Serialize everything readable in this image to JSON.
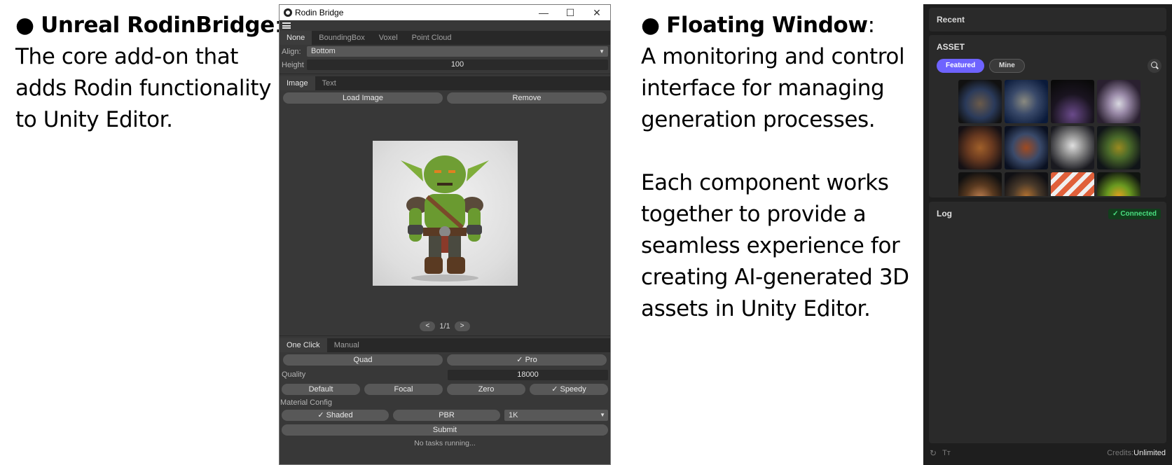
{
  "left_text": {
    "bullet": "●",
    "heading": "Unreal RodinBridge",
    "colon": ":",
    "lines": [
      "The core add-on that",
      "adds Rodin functionality",
      "to Unity Editor."
    ]
  },
  "right_text": {
    "bullet": "●",
    "heading": "Floating Window",
    "colon": ":",
    "lines": [
      "A monitoring and control",
      "interface for managing",
      "generation processes."
    ],
    "lines2": [
      "Each component works",
      "together to provide a",
      "seamless experience for",
      "creating AI-generated 3D",
      "assets in Unity Editor."
    ]
  },
  "rodin_window": {
    "title": "Rodin Bridge",
    "controls": {
      "minimize": "—",
      "maximize": "☐",
      "close": "✕"
    },
    "bbox_tabs": [
      "None",
      "BoundingBox",
      "Voxel",
      "Point Cloud"
    ],
    "align_label": "Align:",
    "align_value": "Bottom",
    "height_label": "Height",
    "height_value": "100",
    "input_tabs": [
      "Image",
      "Text"
    ],
    "load_image": "Load Image",
    "remove": "Remove",
    "pager": {
      "prev": "<",
      "text": "1/1",
      "next": ">"
    },
    "mode_tabs": [
      "One Click",
      "Manual"
    ],
    "quad": "Quad",
    "pro": "✓ Pro",
    "quality_label": "Quality",
    "quality_value": "18000",
    "modes": [
      "Default",
      "Focal",
      "Zero",
      "✓ Speedy"
    ],
    "material_label": "Material Config",
    "shaded": "✓ Shaded",
    "pbr": "PBR",
    "resolution": "1K",
    "submit": "Submit",
    "status": "No tasks running..."
  },
  "floating_window": {
    "recent": "Recent",
    "asset": "ASSET",
    "featured": "Featured",
    "mine": "Mine",
    "log": "Log",
    "connected": "✓ Connected",
    "credits_label": "Credits:",
    "credits_value": "Unlimited",
    "footer_text_icon": "Tт"
  },
  "colors": {
    "accent": "#6e63ff",
    "connected": "#4ade80",
    "window_bg": "#383838",
    "floating_bg": "#1e1e1e"
  }
}
